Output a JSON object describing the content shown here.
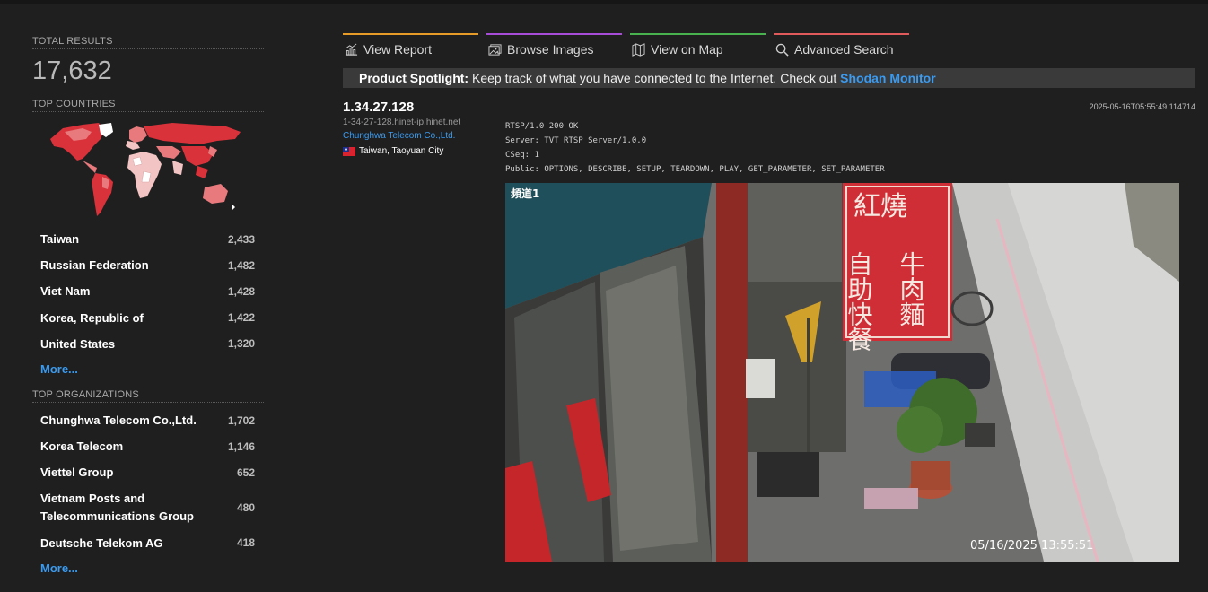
{
  "sidebar": {
    "total_results_label": "TOTAL RESULTS",
    "total_results_value": "17,632",
    "top_countries_label": "TOP COUNTRIES",
    "countries": [
      {
        "name": "Taiwan",
        "count": "2,433"
      },
      {
        "name": "Russian Federation",
        "count": "1,482"
      },
      {
        "name": "Viet Nam",
        "count": "1,428"
      },
      {
        "name": "Korea, Republic of",
        "count": "1,422"
      },
      {
        "name": "United States",
        "count": "1,320"
      }
    ],
    "countries_more": "More...",
    "top_orgs_label": "TOP ORGANIZATIONS",
    "organizations": [
      {
        "name": "Chunghwa Telecom Co.,Ltd.",
        "count": "1,702"
      },
      {
        "name": "Korea Telecom",
        "count": "1,146"
      },
      {
        "name": "Viettel Group",
        "count": "652"
      },
      {
        "name": "Vietnam Posts and Telecommunications Group",
        "count": "480"
      },
      {
        "name": "Deutsche Telekom AG",
        "count": "418"
      }
    ],
    "orgs_more": "More..."
  },
  "tabs": [
    {
      "label": "View Report",
      "icon": "chart-icon",
      "color": "#e69a27"
    },
    {
      "label": "Browse Images",
      "icon": "images-icon",
      "color": "#a64cd8"
    },
    {
      "label": "View on Map",
      "icon": "map-icon",
      "color": "#48b24f"
    },
    {
      "label": "Advanced Search",
      "icon": "search-icon",
      "color": "#e0595b"
    }
  ],
  "spotlight": {
    "label": "Product Spotlight:",
    "text": " Keep track of what you have connected to the Internet. Check out ",
    "link": "Shodan Monitor"
  },
  "result": {
    "ip": "1.34.27.128",
    "hostname": "1-34-27-128.hinet-ip.hinet.net",
    "org": "Chunghwa Telecom Co.,Ltd.",
    "country": "Taiwan",
    "city": ", Taoyuan City",
    "timestamp": "2025-05-16T05:55:49.114714",
    "banner": "RTSP/1.0 200 OK\nServer: TVT RTSP Server/1.0.0\nCSeq: 1\nPublic: OPTIONS, DESCRIBE, SETUP, TEARDOWN, PLAY, GET_PARAMETER, SET_PARAMETER",
    "screenshot": {
      "channel_label": "頻道1",
      "overlay_time": "05/16/2025 13:55:51",
      "sign_left": "紅燒",
      "sign_right": "自助快餐",
      "sign_right2": "牛肉麵"
    }
  },
  "colors": {
    "background": "#1f1f1f",
    "link": "#3a9bf0",
    "map_high": "#d9323a",
    "map_mid": "#e87a7d",
    "map_low": "#f2c4c4"
  }
}
